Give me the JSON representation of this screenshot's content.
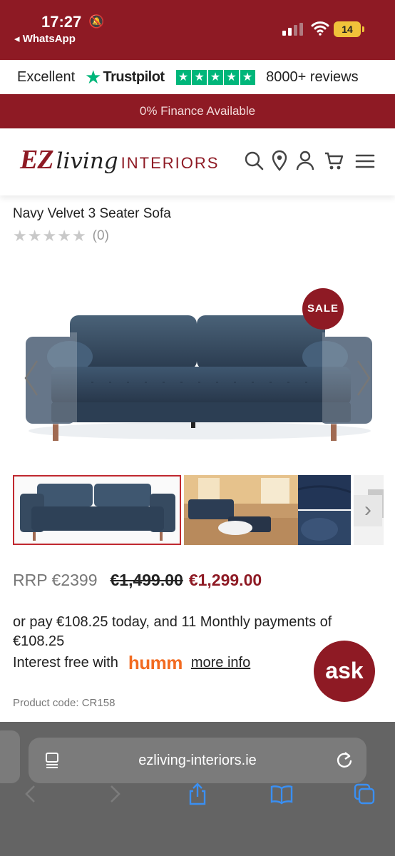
{
  "status_bar": {
    "time": "17:27",
    "back_app": "◂ WhatsApp",
    "battery": "14"
  },
  "trustpilot": {
    "rating_word": "Excellent",
    "brand": "Trustpilot",
    "reviews": "8000+ reviews"
  },
  "promo": {
    "finance": "0% Finance Available"
  },
  "header": {
    "logo_ez": "EZ",
    "logo_living": "living",
    "logo_interiors": "INTERIORS",
    "icons": [
      "search-icon",
      "location-icon",
      "account-icon",
      "cart-icon",
      "menu-icon"
    ]
  },
  "product": {
    "title": "Navy Velvet 3 Seater Sofa",
    "review_count": "(0)",
    "star_rating": 0,
    "badge": "SALE",
    "rrp": "RRP €2399",
    "old_price": "€1,499.00",
    "price": "€1,299.00",
    "payment_text": "or pay €108.25 today, and 11 Monthly payments of €108.25",
    "interest_label": "Interest free with",
    "humm": "humm",
    "more_info": "more info",
    "product_code": "Product code: CR158"
  },
  "chat": {
    "label": "ask"
  },
  "browser": {
    "url": "ezliving-interiors.ie"
  },
  "colors": {
    "brand": "#8e1a24",
    "trustpilot_green": "#00b67a",
    "humm_orange": "#f26b21"
  }
}
